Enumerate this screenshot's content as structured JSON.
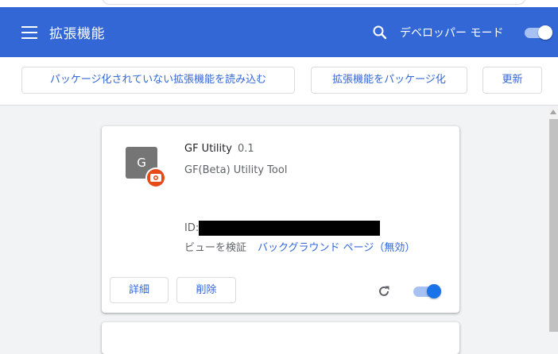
{
  "header": {
    "title": "拡張機能",
    "search_icon": "search-icon",
    "developer_mode_label": "デベロッパー モード",
    "developer_mode_enabled": true
  },
  "toolbar": {
    "load_unpacked_label": "パッケージ化されていない拡張機能を読み込む",
    "pack_extension_label": "拡張機能をパッケージ化",
    "update_label": "更新"
  },
  "extension": {
    "icon_letter": "G",
    "name": "GF Utility",
    "version": "0.1",
    "description": "GF(Beta) Utility Tool",
    "id_label": "ID:",
    "inspect_views_label": "ビューを検証",
    "background_page_link": "バックグラウンド ページ（無効）",
    "details_label": "詳細",
    "remove_label": "削除",
    "enabled": true
  },
  "colors": {
    "header_bg": "#3367d6",
    "accent": "#3367d6",
    "toggle_on": "#1a73e8",
    "badge": "#e64a19"
  }
}
